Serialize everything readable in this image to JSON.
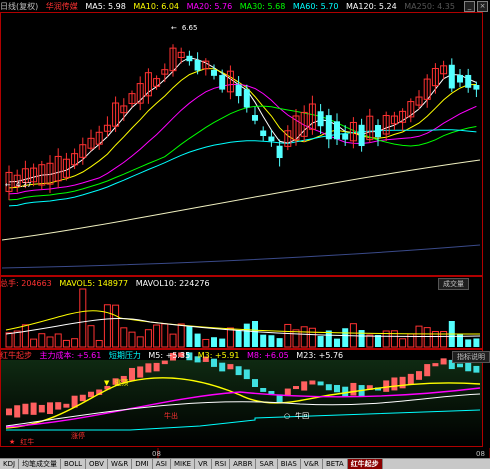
{
  "main_panel": {
    "period": "日线(复权)",
    "stock_name": "华润传媒",
    "ma": [
      {
        "label": "MA5: 5.98",
        "color": "#ffffff"
      },
      {
        "label": "MA10: 6.04",
        "color": "#ffff00"
      },
      {
        "label": "MA20: 5.76",
        "color": "#ff00ff"
      },
      {
        "label": "MA30: 5.68",
        "color": "#00ff00"
      },
      {
        "label": "MA60: 5.70",
        "color": "#00ffff"
      },
      {
        "label": "MA120: 5.24",
        "color": "#ffffff"
      },
      {
        "label": "MA250: 4.35",
        "color": "#555555"
      }
    ],
    "high_label": "6.65",
    "low_label": "4.37"
  },
  "vol_panel": {
    "total_label": "总手: 204663",
    "mavol5_label": "MAVOL5: 148977",
    "mavol10_label": "MAVOL10: 224276",
    "tag_label": "成交量"
  },
  "ind_panel": {
    "title": "红牛起步",
    "labels": [
      {
        "text": "主力成本: +5.61",
        "color": "#ff00ff"
      },
      {
        "text": "短期压力",
        "color": "#00ffff"
      },
      {
        "text": "M5: +5.35",
        "color": "#ffffff"
      },
      {
        "text": "M3: +5.91",
        "color": "#ffff00"
      },
      {
        "text": "M8: +6.05",
        "color": "#ff00ff"
      },
      {
        "text": "M23: +5.76",
        "color": "#ffffff"
      }
    ],
    "help_label": "指标说明",
    "ann_top": "逃顶",
    "ann_zhangting": "涨停",
    "ann_hongniu": "红牛",
    "ann_niuchu": "牛出",
    "ann_niuhui": "牛回"
  },
  "axis": {
    "date_label_1": "08",
    "date_label_2": "08"
  },
  "tabs": [
    "KDJ",
    "均笔成交量",
    "BOLL",
    "OBV",
    "W&R",
    "DMI",
    "ASI",
    "MIKE",
    "VR",
    "RSI",
    "ARBR",
    "SAR",
    "BIAS",
    "V&R",
    "BETA",
    "红牛起步"
  ],
  "colors": {
    "up": "#ff3232",
    "down": "#54ffff",
    "frame": "#b00000"
  }
}
